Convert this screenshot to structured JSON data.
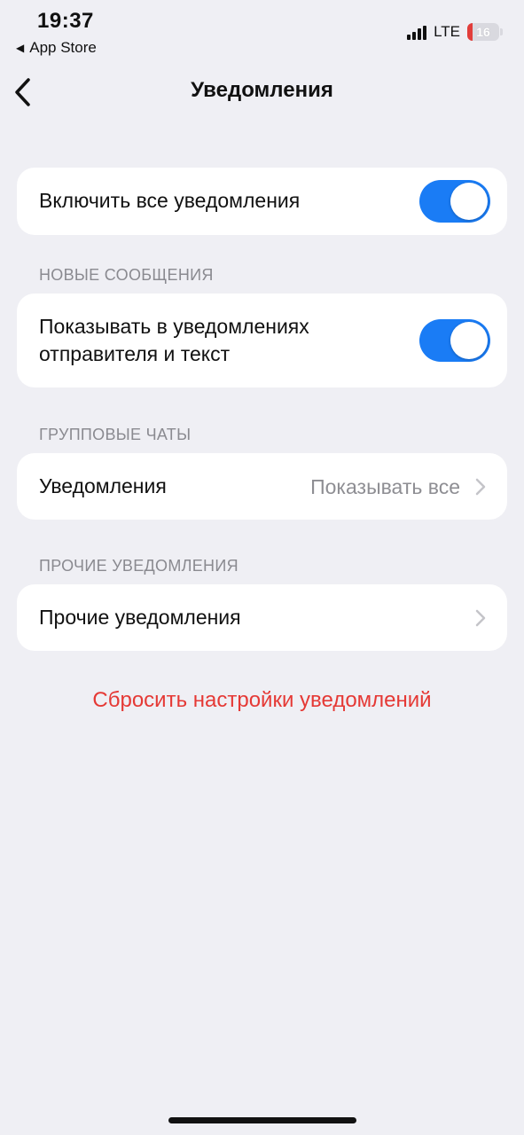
{
  "status_bar": {
    "time": "19:37",
    "back_app_label": "App Store",
    "network": "LTE",
    "battery_level": "16",
    "battery_fraction": 0.16,
    "battery_color": "#e23d3a",
    "signal_icon": "cellular-signal-icon"
  },
  "nav": {
    "title": "Уведомления",
    "back_icon": "chevron-left-icon"
  },
  "all_notifications": {
    "label": "Включить все уведомления",
    "enabled": true
  },
  "new_messages": {
    "header": "НОВЫЕ СООБЩЕНИЯ",
    "preview_label_line1": "Показывать в уведомлениях",
    "preview_label_line2": "отправителя и текст",
    "enabled": true
  },
  "group_chats": {
    "header": "ГРУППОВЫЕ ЧАТЫ",
    "row_label": "Уведомления",
    "row_value": "Показывать все"
  },
  "other": {
    "header": "ПРОЧИЕ УВЕДОМЛЕНИЯ",
    "row_label": "Прочие уведомления"
  },
  "reset_label": "Сбросить настройки уведомлений",
  "colors": {
    "accent": "#1a7cf5",
    "destructive": "#e53935",
    "background": "#efeff4"
  }
}
